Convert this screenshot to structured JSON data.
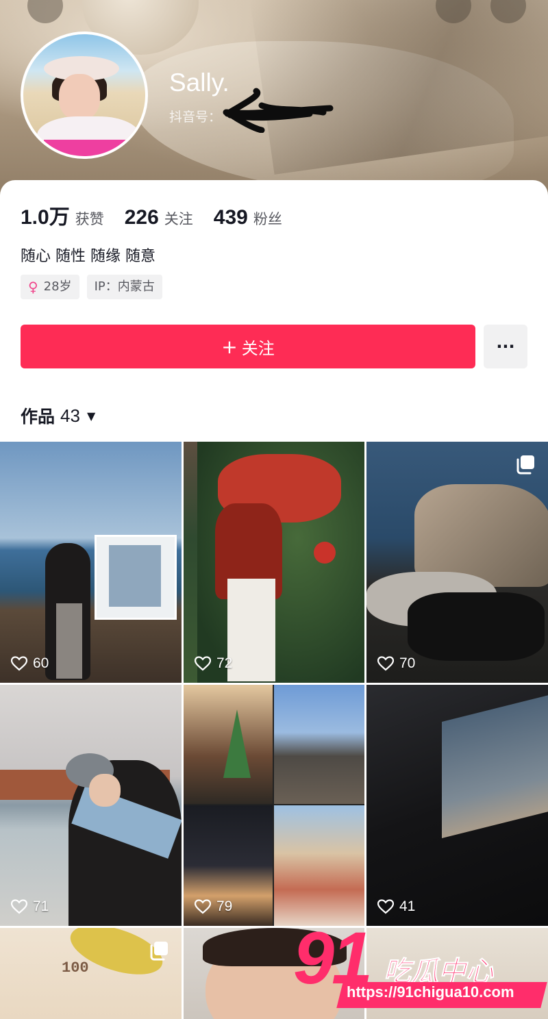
{
  "profile": {
    "name": "Sally.",
    "id_label": "抖音号："
  },
  "stats": [
    {
      "value": "1.0万",
      "label": "获赞"
    },
    {
      "value": "226",
      "label": "关注"
    },
    {
      "value": "439",
      "label": "粉丝"
    }
  ],
  "bio": "随心 随性 随缘 随意",
  "tags": {
    "age": "28岁",
    "ip": "IP：内蒙古"
  },
  "actions": {
    "follow_label": "关注",
    "follow_plus": "+",
    "more_label": "···"
  },
  "works": {
    "label": "作品",
    "count": "43",
    "caret": "▼"
  },
  "grid": {
    "likes": [
      "60",
      "72",
      "70",
      "71",
      "79",
      "41"
    ],
    "tile7_text": "100",
    "icons": {
      "like": "heart-outline-icon",
      "multi": "multi-image-icon"
    }
  },
  "watermark": {
    "number": "91",
    "title": "吃瓜中心",
    "url": "https://91chigua10.com"
  },
  "colors": {
    "accent": "#fe2c55",
    "watermark": "#ff2d6b",
    "text": "#161823",
    "secondary_text": "#57585f",
    "tag_bg": "#f1f1f2"
  }
}
